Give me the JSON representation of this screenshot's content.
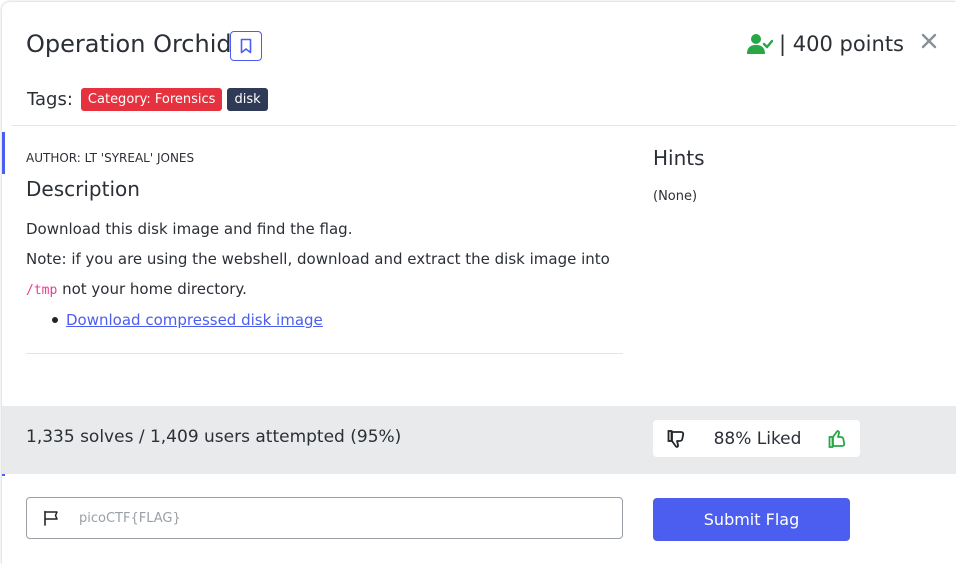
{
  "modal": {
    "title": "Operation Orchid",
    "points_text": "| 400 points",
    "tags_label": "Tags:",
    "tags": [
      {
        "label": "Category: Forensics",
        "color": "#e6323e"
      },
      {
        "label": "disk",
        "color": "#2f3a56"
      }
    ],
    "author": "AUTHOR: LT 'SYREAL' JONES",
    "description_heading": "Description",
    "description_line1": "Download this disk image and find the flag.",
    "description_line2": "Note: if you are using the webshell, download and extract the disk image into",
    "description_code": "/tmp",
    "description_line3_rest": " not your home directory.",
    "download_link": "Download compressed disk image",
    "hints_heading": "Hints",
    "hints_value": "(None)",
    "solves_text": "1,335 solves / 1,409 users attempted (95%)",
    "liked_text": "88% Liked",
    "flag_placeholder": "picoCTF{FLAG}",
    "submit_label": "Submit Flag"
  },
  "icons": {
    "bookmark": "bookmark-icon",
    "user_check": "user-check-icon",
    "close": "close-icon",
    "thumbs_down": "thumbs-down-icon",
    "thumbs_up": "thumbs-up-icon",
    "flag": "flag-icon"
  },
  "colors": {
    "accent": "#4c5ef0",
    "solved_green": "#28a745",
    "category_red": "#e6323e",
    "tag_dark": "#2f3a56",
    "stats_bg": "#e9eaeb"
  }
}
